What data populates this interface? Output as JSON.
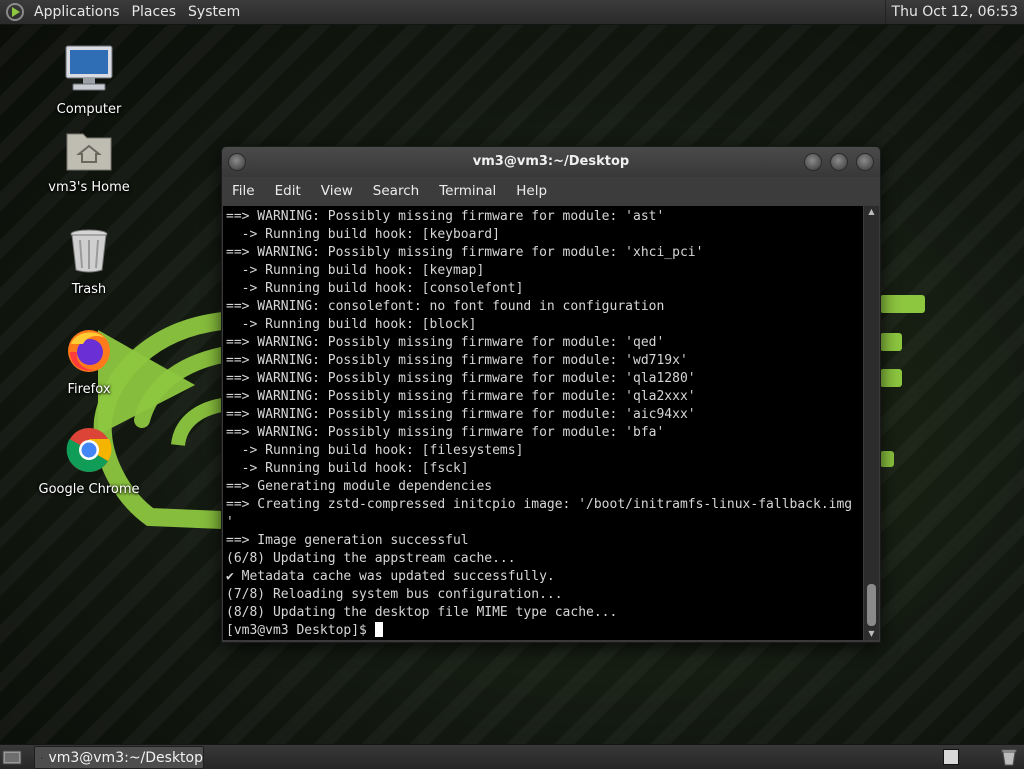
{
  "top_panel": {
    "menus": [
      "Applications",
      "Places",
      "System"
    ],
    "clock": "Thu Oct 12, 06:53"
  },
  "desktop_icons": [
    {
      "label": "Computer",
      "icon": "computer-icon"
    },
    {
      "label": "vm3's Home",
      "icon": "home-folder-icon"
    },
    {
      "label": "Trash",
      "icon": "trash-icon"
    },
    {
      "label": "Firefox",
      "icon": "firefox-icon"
    },
    {
      "label": "Google Chrome",
      "icon": "chrome-icon"
    }
  ],
  "terminal": {
    "title": "vm3@vm3:~/Desktop",
    "menu": [
      "File",
      "Edit",
      "View",
      "Search",
      "Terminal",
      "Help"
    ],
    "lines": [
      "==> WARNING: Possibly missing firmware for module: 'ast'",
      "  -> Running build hook: [keyboard]",
      "==> WARNING: Possibly missing firmware for module: 'xhci_pci'",
      "  -> Running build hook: [keymap]",
      "  -> Running build hook: [consolefont]",
      "==> WARNING: consolefont: no font found in configuration",
      "  -> Running build hook: [block]",
      "==> WARNING: Possibly missing firmware for module: 'qed'",
      "==> WARNING: Possibly missing firmware for module: 'wd719x'",
      "==> WARNING: Possibly missing firmware for module: 'qla1280'",
      "==> WARNING: Possibly missing firmware for module: 'qla2xxx'",
      "==> WARNING: Possibly missing firmware for module: 'aic94xx'",
      "==> WARNING: Possibly missing firmware for module: 'bfa'",
      "  -> Running build hook: [filesystems]",
      "  -> Running build hook: [fsck]",
      "==> Generating module dependencies",
      "==> Creating zstd-compressed initcpio image: '/boot/initramfs-linux-fallback.img",
      "'",
      "==> Image generation successful",
      "(6/8) Updating the appstream cache...",
      "✔ Metadata cache was updated successfully.",
      "(7/8) Reloading system bus configuration...",
      "(8/8) Updating the desktop file MIME type cache..."
    ],
    "prompt": "[vm3@vm3 Desktop]$ "
  },
  "bottom_panel": {
    "task_label": "vm3@vm3:~/Desktop"
  },
  "colors": {
    "accent_green": "#8dc63f"
  }
}
